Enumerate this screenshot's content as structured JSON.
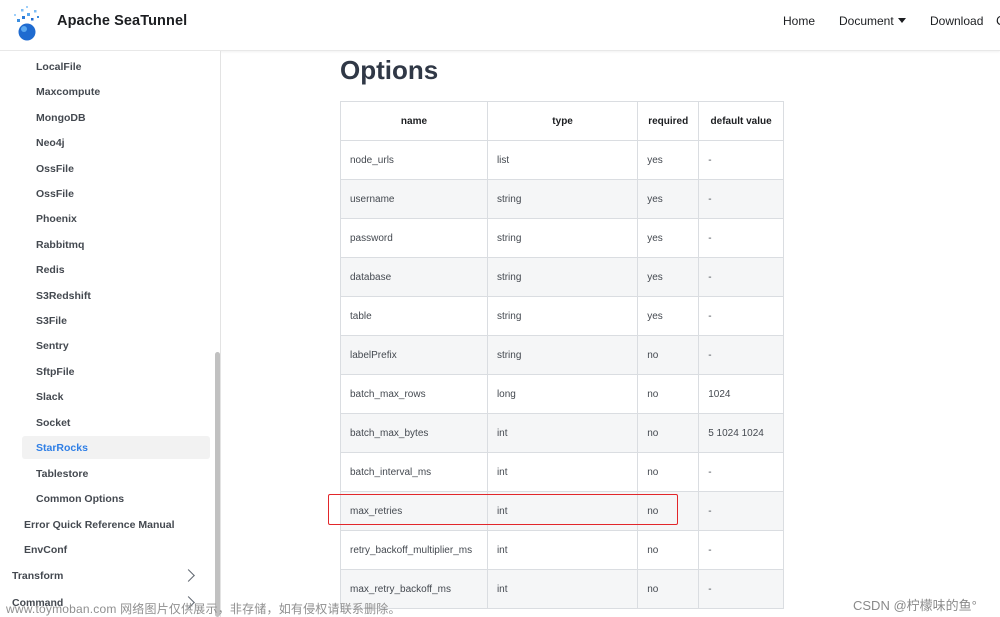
{
  "header": {
    "brand": "Apache SeaTunnel",
    "nav": [
      {
        "label": "Home"
      },
      {
        "label": "Document"
      },
      {
        "label": "Download"
      }
    ],
    "edge_fragment": "C"
  },
  "sidebar": {
    "items": [
      {
        "label": "LocalFile"
      },
      {
        "label": "Maxcompute"
      },
      {
        "label": "MongoDB"
      },
      {
        "label": "Neo4j"
      },
      {
        "label": "OssFile"
      },
      {
        "label": "OssFile"
      },
      {
        "label": "Phoenix"
      },
      {
        "label": "Rabbitmq"
      },
      {
        "label": "Redis"
      },
      {
        "label": "S3Redshift"
      },
      {
        "label": "S3File"
      },
      {
        "label": "Sentry"
      },
      {
        "label": "SftpFile"
      },
      {
        "label": "Slack"
      },
      {
        "label": "Socket"
      },
      {
        "label": "StarRocks",
        "active": true
      },
      {
        "label": "Tablestore"
      },
      {
        "label": "Common Options"
      }
    ],
    "sections": [
      {
        "label": "Error Quick Reference Manual"
      },
      {
        "label": "EnvConf"
      },
      {
        "label": "Transform"
      },
      {
        "label": "Command"
      }
    ]
  },
  "main": {
    "title": "Options",
    "table": {
      "headers": [
        "name",
        "type",
        "required",
        "default value"
      ],
      "rows": [
        {
          "name": "node_urls",
          "type": "list",
          "required": "yes",
          "default_value": "-"
        },
        {
          "name": "username",
          "type": "string",
          "required": "yes",
          "default_value": "-"
        },
        {
          "name": "password",
          "type": "string",
          "required": "yes",
          "default_value": "-"
        },
        {
          "name": "database",
          "type": "string",
          "required": "yes",
          "default_value": "-"
        },
        {
          "name": "table",
          "type": "string",
          "required": "yes",
          "default_value": "-"
        },
        {
          "name": "labelPrefix",
          "type": "string",
          "required": "no",
          "default_value": "-"
        },
        {
          "name": "batch_max_rows",
          "type": "long",
          "required": "no",
          "default_value": "1024"
        },
        {
          "name": "batch_max_bytes",
          "type": "int",
          "required": "no",
          "default_value": "5 1024 1024"
        },
        {
          "name": "batch_interval_ms",
          "type": "int",
          "required": "no",
          "default_value": "-"
        },
        {
          "name": "max_retries",
          "type": "int",
          "required": "no",
          "default_value": "-"
        },
        {
          "name": "retry_backoff_multiplier_ms",
          "type": "int",
          "required": "no",
          "default_value": "-"
        },
        {
          "name": "max_retry_backoff_ms",
          "type": "int",
          "required": "no",
          "default_value": "-"
        }
      ]
    }
  },
  "watermark": {
    "left": "www.toymoban.com 网络图片仅供展示，非存储，如有侵权请联系删除。",
    "right": "CSDN @柠檬味的鱼°"
  },
  "colors": {
    "accent": "#2f7fe6",
    "highlight_box": "#e2262a"
  },
  "icons": {
    "logo": "seatunnel-logo",
    "document_menu": "caret-down-icon",
    "section_toggle": "chevron-right-icon"
  }
}
